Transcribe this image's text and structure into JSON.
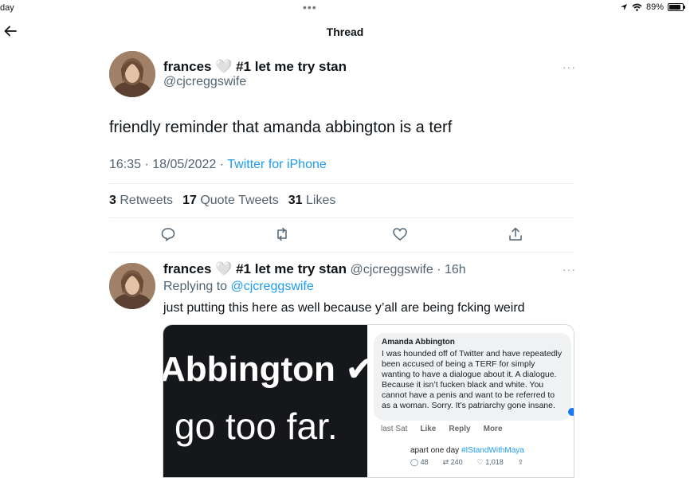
{
  "status_bar": {
    "day": "day",
    "dots": "•••",
    "battery_pct": "89%",
    "battery_fraction": 0.89
  },
  "nav": {
    "title": "Thread"
  },
  "main_tweet": {
    "display_name": "frances 🤍 #1 let me try stan",
    "handle": "@cjcreggswife",
    "text": "friendly reminder that amanda abbington is a terf",
    "datetime": "16:35 · 18/05/2022 · ",
    "source": "Twitter for iPhone",
    "retweets_count": "3",
    "retweets_label": "Retweets",
    "quotes_count": "17",
    "quotes_label": "Quote Tweets",
    "likes_count": "31",
    "likes_label": "Likes",
    "more": "···"
  },
  "reply_tweet": {
    "display_name": "frances 🤍 #1 let me try stan",
    "handle_time": "@cjcreggswife · 16h",
    "replying_prefix": "Replying to ",
    "replying_handle": "@cjcreggswife",
    "text": "just putting this here as well because y’all are being fcking weird",
    "more": "···"
  },
  "media": {
    "left_line1": "Abbington ✔",
    "left_line2": "go too far.",
    "comment_author": "Amanda Abbington",
    "comment_text": "I was hounded off of Twitter and have repeatedly been accused of being a TERF for simply wanting to have a dialogue about it. A dialogue. Because it isn’t fucken black and white. You cannot have a penis and want to be referred to as a woman. Sorry. It’s patriarchy gone insane.",
    "comment_time": "last Sat",
    "comment_like": "Like",
    "comment_reply": "Reply",
    "comment_more": "More",
    "inner_text": "apart one day ",
    "inner_hashtag": "#IStandWithMaya",
    "inner_replies": "48",
    "inner_retweets": "240",
    "inner_likes": "1,018"
  }
}
